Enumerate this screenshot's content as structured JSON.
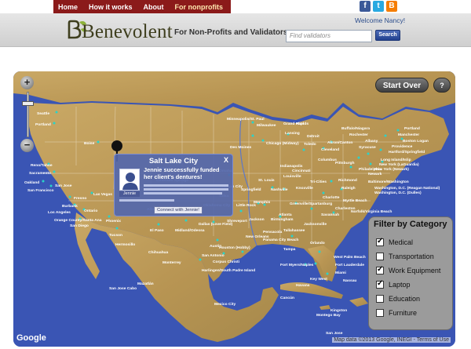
{
  "nav": {
    "items": [
      "Home",
      "How it works",
      "About",
      "For nonprofits"
    ],
    "active": "For nonprofits"
  },
  "social": {
    "icons": [
      "facebook-icon",
      "twitter-icon",
      "blogger-icon"
    ],
    "colors": [
      "#3b5998",
      "#29a9e1",
      "#f57d00"
    ]
  },
  "header": {
    "logo": "Benevolent",
    "tagline": "For Non-Profits and Validators",
    "welcome": "Welcome Nancy!",
    "search_placeholder": "Find validators",
    "search_button": "Search"
  },
  "map": {
    "start_over": "Start Over",
    "help": "?",
    "zoom_in": "+",
    "zoom_out": "−",
    "google_logo": "Google",
    "attribution": "Map data ©2013  Google, INEGI - Terms of Use",
    "cities": [
      "Seattle",
      "Portland",
      "Boise",
      "Reno/Tahoe",
      "Sacramento",
      "Oakland",
      "San Francisco",
      "San Jose",
      "Fresno",
      "Las Vegas",
      "Burbank",
      "Los Angeles",
      "Ontario",
      "Orange County/Santa Ana",
      "San Diego",
      "Phoenix",
      "Tucson",
      "Albuquerque",
      "El Paso",
      "Midland/Odessa",
      "Lubbock",
      "Denver",
      "Colorado Springs",
      "Kansas City",
      "Omaha",
      "Minneapolis/St. Paul",
      "Des Moines",
      "Milwaukee",
      "Chicago (Midway)",
      "Grand Rapids",
      "Flint",
      "Lansing",
      "Detroit",
      "Toledo",
      "Cleveland",
      "Akron/Canton",
      "Columbus",
      "Cincinnati",
      "Pittsburgh",
      "Indianapolis",
      "Louisville",
      "St. Louis",
      "Springfield",
      "Tulsa",
      "Oklahoma City",
      "Little Rock",
      "Memphis",
      "Nashville",
      "Knoxville",
      "Tri-Cities",
      "Charlotte",
      "Greenville/Spartanburg",
      "Atlanta",
      "Birmingham",
      "Jackson",
      "Shreveport",
      "Dallas (Love Field)",
      "Austin",
      "San Antonio",
      "Houston (Hobby)",
      "Harlingen/South Padre Island",
      "Corpus Christi",
      "New Orleans",
      "Pensacola",
      "Panama City Beach",
      "Tallahassee",
      "Jacksonville",
      "Orlando",
      "Tampa",
      "Fort Myers/Naples",
      "West Palm Beach",
      "Fort Lauderdale",
      "Miami",
      "Key West",
      "Savannah",
      "Charleston",
      "Myrtle Beach",
      "Raleigh",
      "Norfolk/Virginia Beach",
      "Richmond",
      "Washington, D.C. (Reagan National)",
      "Washington, D.C. (Dulles)",
      "Baltimore/Washington",
      "Philadelphia",
      "Newark",
      "New York (Newark)",
      "New York (LaGuardia)",
      "Long Island/Islip",
      "Hartford/Springfield",
      "Providence",
      "Boston Logan",
      "Manchester",
      "Portland",
      "Buffalo/Niagara",
      "Rochester",
      "Albany",
      "Syracuse",
      "Monterrey",
      "Chihuahua",
      "Hermosillo",
      "Mazatlán",
      "San Jose Cabo",
      "Mexico City",
      "Cancún",
      "Montego Bay",
      "Kingston",
      "Havana",
      "Nassau",
      "San Jose"
    ]
  },
  "popup": {
    "title": "Salt Lake City",
    "close": "X",
    "message": "Jennie successfully funded her client's dentures!",
    "avatar_name": "Jennie",
    "connect_button": "Connect with Jennie!"
  },
  "filter": {
    "title": "Filter by Category",
    "items": [
      {
        "label": "Medical",
        "checked": true
      },
      {
        "label": "Transportation",
        "checked": false
      },
      {
        "label": "Work Equipment",
        "checked": true
      },
      {
        "label": "Laptop",
        "checked": true
      },
      {
        "label": "Education",
        "checked": false
      },
      {
        "label": "Furniture",
        "checked": false
      }
    ]
  }
}
